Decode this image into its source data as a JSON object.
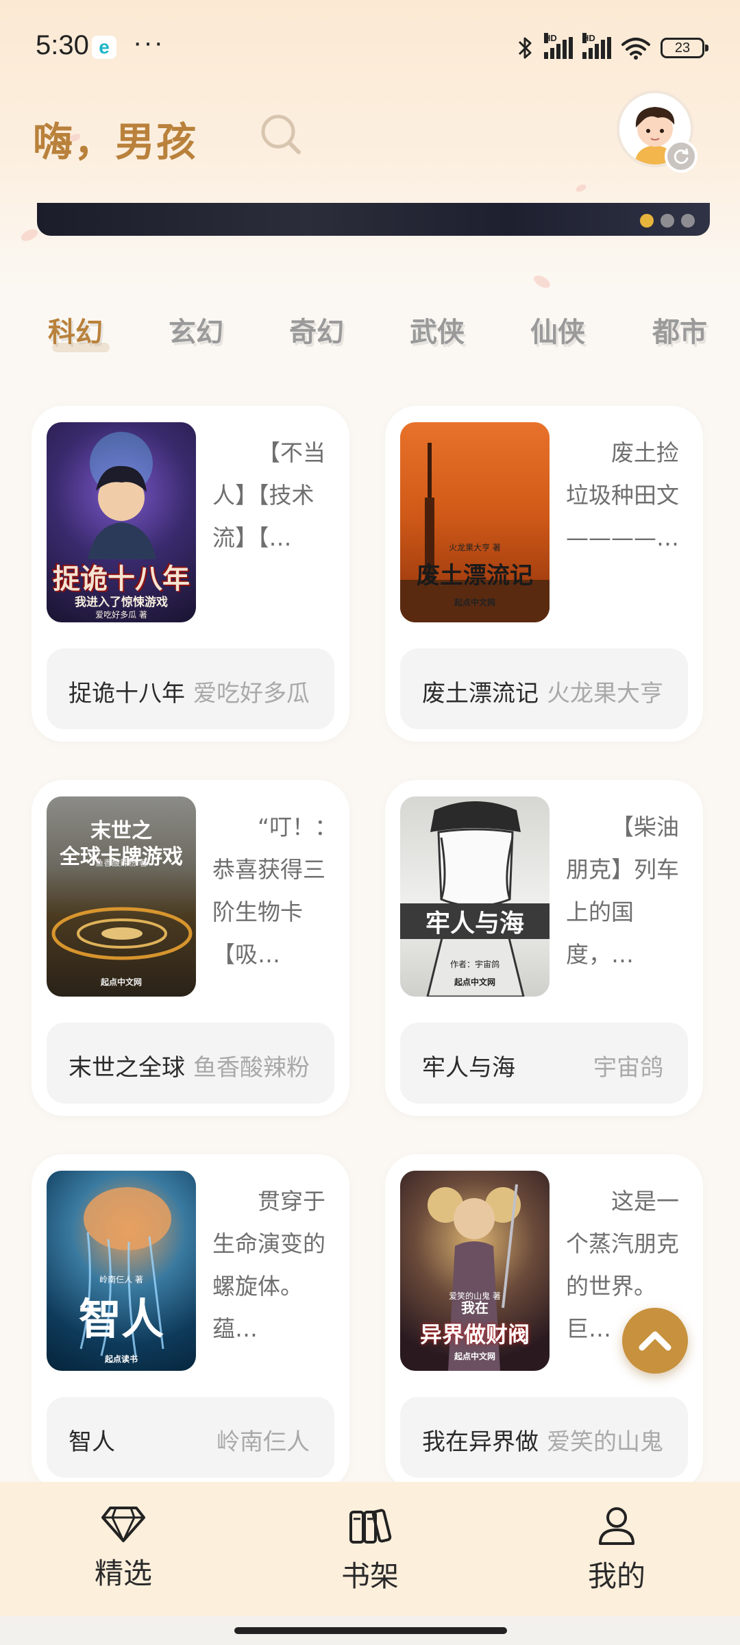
{
  "status_bar": {
    "time": "5:30",
    "app_icon_letter": "e",
    "more": "···",
    "signal1_label": "HD",
    "signal2_label": "HD",
    "battery": "23"
  },
  "header": {
    "greeting": "嗨，男孩"
  },
  "banner": {
    "page_count": 3,
    "active_index": 0
  },
  "categories": [
    {
      "label": "科幻",
      "active": true
    },
    {
      "label": "玄幻",
      "active": false
    },
    {
      "label": "奇幻",
      "active": false
    },
    {
      "label": "武侠",
      "active": false
    },
    {
      "label": "仙侠",
      "active": false
    },
    {
      "label": "都市",
      "active": false
    }
  ],
  "books": [
    {
      "title": "捉诡十八年",
      "author": "爱吃好多瓜",
      "desc": "【不当人】【技术流】【…",
      "cover_title": "捉诡十八年",
      "cover_subtitle": "我进入了惊悚游戏",
      "cover_author": "爱吃好多瓜 著"
    },
    {
      "title": "废土漂流记",
      "author": "火龙果大亨",
      "desc": "废土捡垃圾种田文————…",
      "cover_title": "废土漂流记",
      "cover_author": "火龙果大亨 著",
      "cover_publisher": "起点中文网"
    },
    {
      "title": "末世之全球",
      "author": "鱼香酸辣粉",
      "desc": "“叮！：恭喜获得三阶生物卡【吸…",
      "cover_title": "末世之\n全球卡牌游戏",
      "cover_author": "鱼香酸辣粉 著",
      "cover_publisher": "起点中文网"
    },
    {
      "title": "牢人与海",
      "author": "宇宙鸽",
      "desc": "【柴油朋克】列车上的国度，…",
      "cover_title": "牢人与海",
      "cover_author": "作者：宇宙鸽",
      "cover_publisher": "起点中文网"
    },
    {
      "title": "智人",
      "author": "岭南仨人",
      "desc": "贯穿于生命演变的螺旋体。蕴…",
      "cover_title": "智人",
      "cover_author": "岭南仨人 著",
      "cover_publisher": "起点读书"
    },
    {
      "title": "我在异界做",
      "author": "爱笑的山鬼",
      "desc": "这是一个蒸汽朋克的世界。巨…",
      "cover_title_small": "我在",
      "cover_title": "异界做财阀",
      "cover_author": "爱笑的山鬼 著",
      "cover_publisher": "起点中文网"
    }
  ],
  "bottom_nav": [
    {
      "label": "精选",
      "icon": "diamond-icon",
      "active": true
    },
    {
      "label": "书架",
      "icon": "bookshelf-icon",
      "active": false
    },
    {
      "label": "我的",
      "icon": "person-icon",
      "active": false
    }
  ],
  "colors": {
    "accent": "#b9813b",
    "back_to_top": "#c8913d",
    "nav_bg": "#fcefdc"
  }
}
